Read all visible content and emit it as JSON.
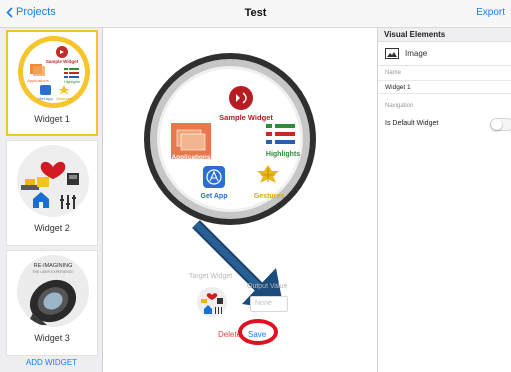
{
  "nav": {
    "back_label": "Projects",
    "title": "Test",
    "export_label": "Export"
  },
  "sidebar": {
    "widgets": [
      {
        "label": "Widget 1",
        "thumb": "widget-1-thumbnail",
        "texts": [
          "Sample Widget",
          "Applications",
          "Highlights",
          "Get App",
          "Gestures"
        ]
      },
      {
        "label": "Widget 2",
        "thumb": "widget-2-thumbnail"
      },
      {
        "label": "Widget 3",
        "thumb": "widget-3-thumbnail",
        "texts": [
          "RE-IMAGINING",
          "THE USER EXPERIENCE"
        ]
      }
    ],
    "add_widget_label": "ADD WIDGET"
  },
  "canvas": {
    "preview": {
      "sample_widget": "Sample Widget",
      "applications": "Applications",
      "highlights": "Highlights",
      "get_app": "Get App",
      "gestures": "Gestures"
    },
    "target_widget_label": "Target Widget",
    "output_value_label": "Output Value",
    "output_placeholder": "None",
    "delete_label": "Delete",
    "save_label": "Save"
  },
  "panel": {
    "header": "Visual Elements",
    "element_label": "Image",
    "name_label": "Name",
    "name_value": "Widget 1",
    "navigation_label": "Navigation",
    "default_widget_label": "Is Default Widget",
    "default_widget_on": false
  },
  "colors": {
    "accent": "#1a7cf5",
    "delete": "#e04444",
    "highlight_ring": "#e01020",
    "annotation_arrow": "#1b4c7c"
  }
}
